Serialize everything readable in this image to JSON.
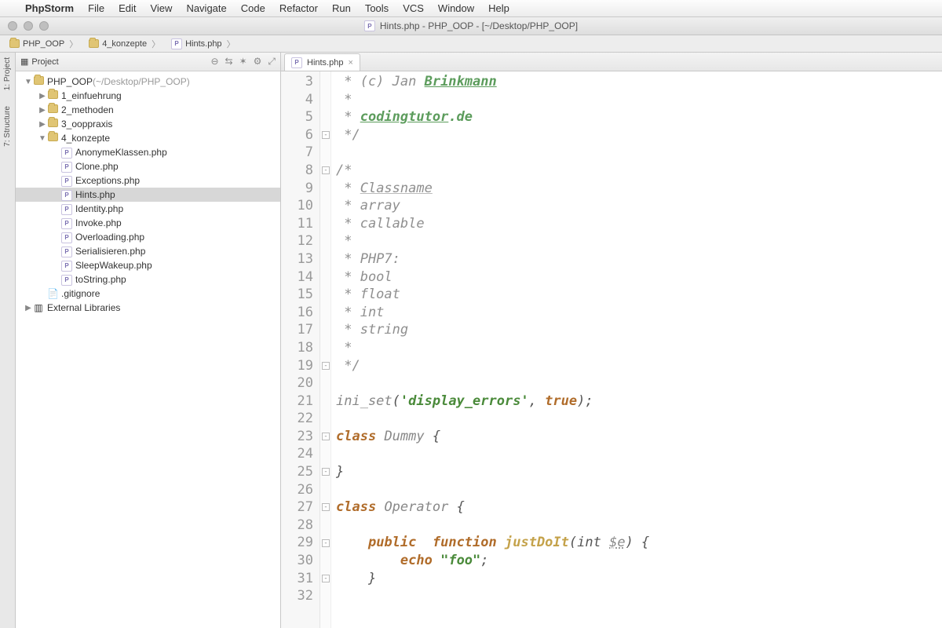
{
  "mac_menu": {
    "apple": "",
    "app": "PhpStorm",
    "items": [
      "File",
      "Edit",
      "View",
      "Navigate",
      "Code",
      "Refactor",
      "Run",
      "Tools",
      "VCS",
      "Window",
      "Help"
    ]
  },
  "window_title": "Hints.php - PHP_OOP - [~/Desktop/PHP_OOP]",
  "breadcrumbs": [
    {
      "icon": "folder",
      "label": "PHP_OOP"
    },
    {
      "icon": "folder",
      "label": "4_konzepte"
    },
    {
      "icon": "php",
      "label": "Hints.php"
    }
  ],
  "left_tabs": [
    "1: Project",
    "7: Structure"
  ],
  "project_panel": {
    "title": "Project",
    "tool_icons": [
      "⊖",
      "⇆",
      "✶",
      "⚙",
      "⤢"
    ],
    "tree": [
      {
        "depth": 0,
        "exp": "▼",
        "icon": "folder",
        "label": "PHP_OOP",
        "suffix": " (~/Desktop/PHP_OOP)"
      },
      {
        "depth": 1,
        "exp": "▶",
        "icon": "folder",
        "label": "1_einfuehrung"
      },
      {
        "depth": 1,
        "exp": "▶",
        "icon": "folder",
        "label": "2_methoden"
      },
      {
        "depth": 1,
        "exp": "▶",
        "icon": "folder",
        "label": "3_ooppraxis"
      },
      {
        "depth": 1,
        "exp": "▼",
        "icon": "folder",
        "label": "4_konzepte"
      },
      {
        "depth": 2,
        "exp": "",
        "icon": "php",
        "label": "AnonymeKlassen.php"
      },
      {
        "depth": 2,
        "exp": "",
        "icon": "php",
        "label": "Clone.php"
      },
      {
        "depth": 2,
        "exp": "",
        "icon": "php",
        "label": "Exceptions.php"
      },
      {
        "depth": 2,
        "exp": "",
        "icon": "php",
        "label": "Hints.php",
        "selected": true
      },
      {
        "depth": 2,
        "exp": "",
        "icon": "php",
        "label": "Identity.php"
      },
      {
        "depth": 2,
        "exp": "",
        "icon": "php",
        "label": "Invoke.php"
      },
      {
        "depth": 2,
        "exp": "",
        "icon": "php",
        "label": "Overloading.php"
      },
      {
        "depth": 2,
        "exp": "",
        "icon": "php",
        "label": "Serialisieren.php"
      },
      {
        "depth": 2,
        "exp": "",
        "icon": "php",
        "label": "SleepWakeup.php"
      },
      {
        "depth": 2,
        "exp": "",
        "icon": "php",
        "label": "toString.php"
      },
      {
        "depth": 1,
        "exp": "",
        "icon": "file",
        "label": ".gitignore"
      },
      {
        "depth": 0,
        "exp": "▶",
        "icon": "lib",
        "label": "External Libraries"
      }
    ]
  },
  "editor": {
    "tab_label": "Hints.php",
    "first_line_no": 3,
    "lines": [
      {
        "html": "<span class='c-doc'> * (c) Jan </span><span class='c-link'>Brinkmann</span>"
      },
      {
        "html": "<span class='c-doc'> *</span>"
      },
      {
        "html": "<span class='c-doc'> * </span><span class='c-link'>codingtutor</span><span class='c-green'>.de</span>"
      },
      {
        "html": "<span class='c-doc'> */</span>",
        "fold": "⊟"
      },
      {
        "html": ""
      },
      {
        "html": "<span class='c-comment'>/*</span>",
        "fold": "⊟"
      },
      {
        "html": "<span class='c-comment'> * </span><span class='c-comment underline-gray'>Classname</span>"
      },
      {
        "html": "<span class='c-comment'> * array</span>"
      },
      {
        "html": "<span class='c-comment'> * callable</span>"
      },
      {
        "html": "<span class='c-comment'> *</span>"
      },
      {
        "html": "<span class='c-comment'> * PHP7:</span>"
      },
      {
        "html": "<span class='c-comment'> * bool</span>"
      },
      {
        "html": "<span class='c-comment'> * float</span>"
      },
      {
        "html": "<span class='c-comment'> * int</span>"
      },
      {
        "html": "<span class='c-comment'> * string</span>"
      },
      {
        "html": "<span class='c-comment'> *</span>"
      },
      {
        "html": "<span class='c-comment'> */</span>",
        "fold": "⊟"
      },
      {
        "html": ""
      },
      {
        "html": "<span class='c-fn'>ini_set</span>(<span class='c-str'>'display_errors'</span>, <span class='c-kw'>true</span>);"
      },
      {
        "html": ""
      },
      {
        "html": "<span class='c-kw'>class</span> <span class='c-class'>Dummy</span> {",
        "fold": "⊟"
      },
      {
        "html": ""
      },
      {
        "html": "}",
        "fold": "⊟"
      },
      {
        "html": ""
      },
      {
        "html": "<span class='c-kw'>class</span> <span class='c-class'>Operator</span> {",
        "fold": "⊟"
      },
      {
        "html": ""
      },
      {
        "html": "    <span class='c-kw'>public</span>  <span class='c-kw'>function</span> <span class='c-func'>justDoIt</span>(int <span class='c-var'>$e</span>) {",
        "fold": "⊟"
      },
      {
        "html": "        <span class='c-kw'>echo</span> <span class='c-str'>\"foo\"</span>;"
      },
      {
        "html": "    }",
        "fold": "⊟"
      },
      {
        "html": ""
      }
    ]
  }
}
